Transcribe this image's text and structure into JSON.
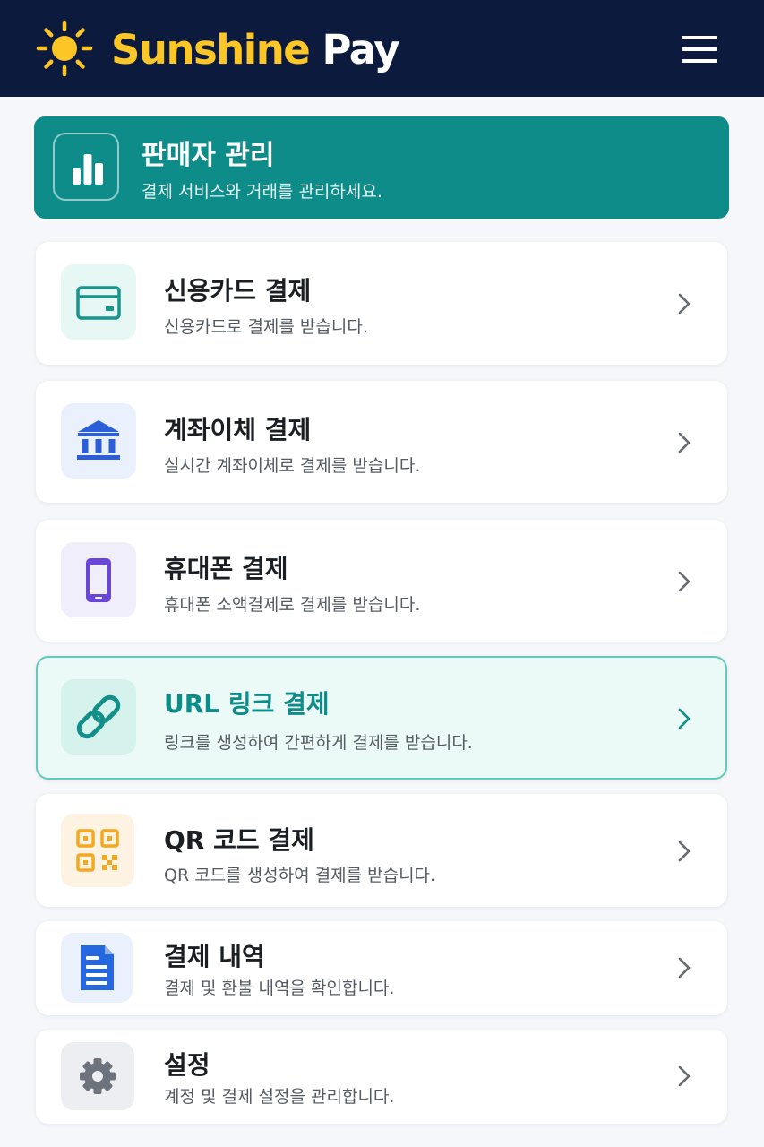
{
  "header": {
    "brand_part1": "Sunshine",
    "brand_part2": "Pay",
    "logo_icon": "sun-icon",
    "menu_icon": "hamburger-menu-icon"
  },
  "banner": {
    "title": "판매자 관리",
    "subtitle": "결제 서비스와 거래를 관리하세요.",
    "icon": "bar-chart-icon"
  },
  "menu": [
    {
      "title": "신용카드 결제",
      "subtitle": "신용카드로 결제를 받습니다.",
      "icon": "credit-card-icon"
    },
    {
      "title": "계좌이체 결제",
      "subtitle": "실시간 계좌이체로 결제를 받습니다.",
      "icon": "bank-icon"
    },
    {
      "title": "휴대폰 결제",
      "subtitle": "휴대폰 소액결제로 결제를 받습니다.",
      "icon": "mobile-phone-icon"
    },
    {
      "title": "URL 링크 결제",
      "subtitle": "링크를 생성하여 간편하게 결제를 받습니다.",
      "icon": "link-icon",
      "selected": true
    },
    {
      "title": "QR 코드 결제",
      "subtitle": "QR 코드를 생성하여 결제를 받습니다.",
      "icon": "qr-code-icon"
    },
    {
      "title": "결제 내역",
      "subtitle": "결제 및 환불 내역을 확인합니다.",
      "icon": "document-icon"
    },
    {
      "title": "설정",
      "subtitle": "계정 및 결제 설정을 관리합니다.",
      "icon": "gear-icon"
    }
  ],
  "colors": {
    "header_bg": "#0c1a3d",
    "brand_yellow": "#fdc627",
    "teal": "#0d8c89",
    "selected_bg": "#ebfaf7",
    "selected_border": "#62c9bd"
  }
}
